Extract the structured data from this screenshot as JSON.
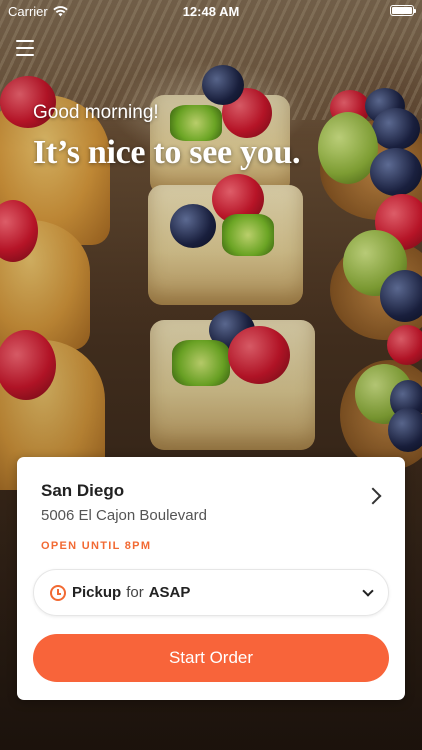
{
  "status_bar": {
    "carrier": "Carrier",
    "time": "12:48 AM"
  },
  "header": {
    "greeting": "Good morning!",
    "headline": "It’s nice to see you."
  },
  "store": {
    "name": "San Diego",
    "address": "5006 El Cajon Boulevard",
    "hours": "OPEN UNTIL 8PM"
  },
  "order_mode": {
    "method": "Pickup",
    "connector": "for",
    "time": "ASAP"
  },
  "actions": {
    "start_order": "Start Order"
  },
  "colors": {
    "accent": "#f8643a",
    "hours_text": "#f26a33"
  }
}
